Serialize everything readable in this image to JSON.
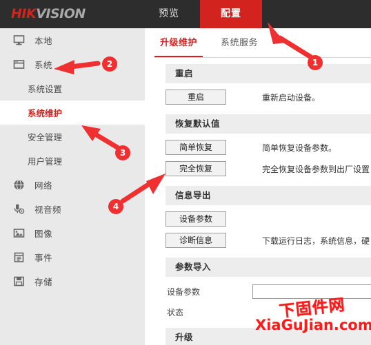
{
  "header": {
    "logo_hik": "HIK",
    "logo_vision": "VISION",
    "nav": [
      {
        "label": "预览",
        "active": false
      },
      {
        "label": "配置",
        "active": true
      }
    ]
  },
  "sidebar": {
    "items": [
      {
        "label": "本地",
        "icon": "monitor-icon",
        "type": "top"
      },
      {
        "label": "系统",
        "icon": "window-icon",
        "type": "top"
      },
      {
        "label": "系统设置",
        "type": "sub",
        "active": false
      },
      {
        "label": "系统维护",
        "type": "sub",
        "active": true
      },
      {
        "label": "安全管理",
        "type": "sub",
        "active": false
      },
      {
        "label": "用户管理",
        "type": "sub",
        "active": false
      },
      {
        "label": "网络",
        "icon": "globe-icon",
        "type": "top"
      },
      {
        "label": "视音频",
        "icon": "microphone-icon",
        "type": "top"
      },
      {
        "label": "图像",
        "icon": "image-icon",
        "type": "top"
      },
      {
        "label": "事件",
        "icon": "event-icon",
        "type": "top"
      },
      {
        "label": "存储",
        "icon": "save-icon",
        "type": "top"
      }
    ]
  },
  "main": {
    "tabs": [
      {
        "label": "升级维护",
        "active": true
      },
      {
        "label": "系统服务",
        "active": false
      }
    ],
    "sections": [
      {
        "title": "重启",
        "rows": [
          {
            "button": "重启",
            "desc": "重新启动设备。"
          }
        ]
      },
      {
        "title": "恢复默认值",
        "rows": [
          {
            "button": "简单恢复",
            "desc": "简单恢复设备参数。"
          },
          {
            "button": "完全恢复",
            "desc": "完全恢复设备参数到出厂设置"
          }
        ]
      },
      {
        "title": "信息导出",
        "rows": [
          {
            "button": "设备参数",
            "desc": ""
          },
          {
            "button": "诊断信息",
            "desc": "下载运行日志，系统信息，硬"
          }
        ]
      }
    ],
    "import_section": {
      "title": "参数导入",
      "field_label": "设备参数",
      "field_value": "",
      "status_label": "状态",
      "status_value": ""
    },
    "upgrade_section": {
      "title": "升级"
    }
  },
  "annotations": {
    "markers": [
      {
        "number": "1"
      },
      {
        "number": "2"
      },
      {
        "number": "3"
      },
      {
        "number": "4"
      }
    ]
  },
  "watermark": {
    "chinese": "下固件网",
    "domain": "XiaGuJian.com"
  }
}
